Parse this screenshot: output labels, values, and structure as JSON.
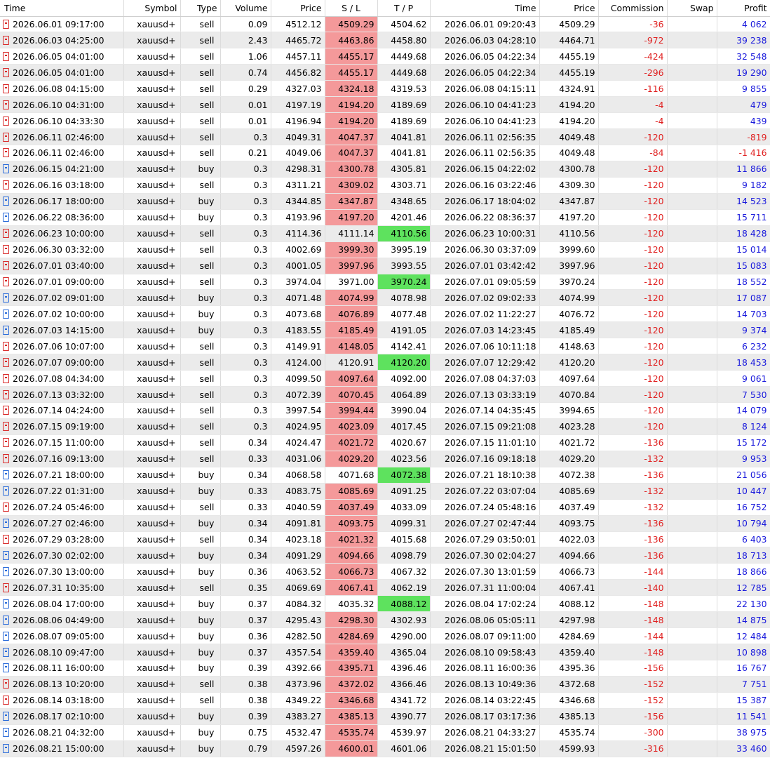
{
  "columns": [
    "Time",
    "Symbol",
    "Type",
    "Volume",
    "Price",
    "S / L",
    "T / P",
    "Time",
    "Price",
    "Commission",
    "Swap",
    "Profit"
  ],
  "rows": [
    {
      "t": "2026.06.01 09:17:00",
      "s": "xauusd+",
      "ty": "sell",
      "v": "0.09",
      "p": "4512.12",
      "sl": "4509.29",
      "tp": "4504.62",
      "ct": "2026.06.01 09:20:43",
      "cp": "4509.29",
      "c": "-36",
      "sw": "",
      "pr": "4 062",
      "hit": "sl"
    },
    {
      "t": "2026.06.03 04:25:00",
      "s": "xauusd+",
      "ty": "sell",
      "v": "2.43",
      "p": "4465.72",
      "sl": "4463.86",
      "tp": "4458.80",
      "ct": "2026.06.03 04:28:10",
      "cp": "4464.71",
      "c": "-972",
      "sw": "",
      "pr": "39 238",
      "hit": "sl"
    },
    {
      "t": "2026.06.05 04:01:00",
      "s": "xauusd+",
      "ty": "sell",
      "v": "1.06",
      "p": "4457.11",
      "sl": "4455.17",
      "tp": "4449.68",
      "ct": "2026.06.05 04:22:34",
      "cp": "4455.19",
      "c": "-424",
      "sw": "",
      "pr": "32 548",
      "hit": "sl"
    },
    {
      "t": "2026.06.05 04:01:00",
      "s": "xauusd+",
      "ty": "sell",
      "v": "0.74",
      "p": "4456.82",
      "sl": "4455.17",
      "tp": "4449.68",
      "ct": "2026.06.05 04:22:34",
      "cp": "4455.19",
      "c": "-296",
      "sw": "",
      "pr": "19 290",
      "hit": "sl"
    },
    {
      "t": "2026.06.08 04:15:00",
      "s": "xauusd+",
      "ty": "sell",
      "v": "0.29",
      "p": "4327.03",
      "sl": "4324.18",
      "tp": "4319.53",
      "ct": "2026.06.08 04:15:11",
      "cp": "4324.91",
      "c": "-116",
      "sw": "",
      "pr": "9 855",
      "hit": "sl"
    },
    {
      "t": "2026.06.10 04:31:00",
      "s": "xauusd+",
      "ty": "sell",
      "v": "0.01",
      "p": "4197.19",
      "sl": "4194.20",
      "tp": "4189.69",
      "ct": "2026.06.10 04:41:23",
      "cp": "4194.20",
      "c": "-4",
      "sw": "",
      "pr": "479",
      "hit": "sl"
    },
    {
      "t": "2026.06.10 04:33:30",
      "s": "xauusd+",
      "ty": "sell",
      "v": "0.01",
      "p": "4196.94",
      "sl": "4194.20",
      "tp": "4189.69",
      "ct": "2026.06.10 04:41:23",
      "cp": "4194.20",
      "c": "-4",
      "sw": "",
      "pr": "439",
      "hit": "sl"
    },
    {
      "t": "2026.06.11 02:46:00",
      "s": "xauusd+",
      "ty": "sell",
      "v": "0.3",
      "p": "4049.31",
      "sl": "4047.37",
      "tp": "4041.81",
      "ct": "2026.06.11 02:56:35",
      "cp": "4049.48",
      "c": "-120",
      "sw": "",
      "pr": "-819",
      "hit": "sl"
    },
    {
      "t": "2026.06.11 02:46:00",
      "s": "xauusd+",
      "ty": "sell",
      "v": "0.21",
      "p": "4049.06",
      "sl": "4047.37",
      "tp": "4041.81",
      "ct": "2026.06.11 02:56:35",
      "cp": "4049.48",
      "c": "-84",
      "sw": "",
      "pr": "-1 416",
      "hit": "sl"
    },
    {
      "t": "2026.06.15 04:21:00",
      "s": "xauusd+",
      "ty": "buy",
      "v": "0.3",
      "p": "4298.31",
      "sl": "4300.78",
      "tp": "4305.81",
      "ct": "2026.06.15 04:22:02",
      "cp": "4300.78",
      "c": "-120",
      "sw": "",
      "pr": "11 866",
      "hit": "sl"
    },
    {
      "t": "2026.06.16 03:18:00",
      "s": "xauusd+",
      "ty": "sell",
      "v": "0.3",
      "p": "4311.21",
      "sl": "4309.02",
      "tp": "4303.71",
      "ct": "2026.06.16 03:22:46",
      "cp": "4309.30",
      "c": "-120",
      "sw": "",
      "pr": "9 182",
      "hit": "sl"
    },
    {
      "t": "2026.06.17 18:00:00",
      "s": "xauusd+",
      "ty": "buy",
      "v": "0.3",
      "p": "4344.85",
      "sl": "4347.87",
      "tp": "4348.65",
      "ct": "2026.06.17 18:04:02",
      "cp": "4347.87",
      "c": "-120",
      "sw": "",
      "pr": "14 523",
      "hit": "sl"
    },
    {
      "t": "2026.06.22 08:36:00",
      "s": "xauusd+",
      "ty": "buy",
      "v": "0.3",
      "p": "4193.96",
      "sl": "4197.20",
      "tp": "4201.46",
      "ct": "2026.06.22 08:36:37",
      "cp": "4197.20",
      "c": "-120",
      "sw": "",
      "pr": "15 711",
      "hit": "sl"
    },
    {
      "t": "2026.06.23 10:00:00",
      "s": "xauusd+",
      "ty": "sell",
      "v": "0.3",
      "p": "4114.36",
      "sl": "4111.14",
      "tp": "4110.56",
      "ct": "2026.06.23 10:00:31",
      "cp": "4110.56",
      "c": "-120",
      "sw": "",
      "pr": "18 428",
      "hit": "tp"
    },
    {
      "t": "2026.06.30 03:32:00",
      "s": "xauusd+",
      "ty": "sell",
      "v": "0.3",
      "p": "4002.69",
      "sl": "3999.30",
      "tp": "3995.19",
      "ct": "2026.06.30 03:37:09",
      "cp": "3999.60",
      "c": "-120",
      "sw": "",
      "pr": "15 014",
      "hit": "sl"
    },
    {
      "t": "2026.07.01 03:40:00",
      "s": "xauusd+",
      "ty": "sell",
      "v": "0.3",
      "p": "4001.05",
      "sl": "3997.96",
      "tp": "3993.55",
      "ct": "2026.07.01 03:42:42",
      "cp": "3997.96",
      "c": "-120",
      "sw": "",
      "pr": "15 083",
      "hit": "sl"
    },
    {
      "t": "2026.07.01 09:00:00",
      "s": "xauusd+",
      "ty": "sell",
      "v": "0.3",
      "p": "3974.04",
      "sl": "3971.00",
      "tp": "3970.24",
      "ct": "2026.07.01 09:05:59",
      "cp": "3970.24",
      "c": "-120",
      "sw": "",
      "pr": "18 552",
      "hit": "tp"
    },
    {
      "t": "2026.07.02 09:01:00",
      "s": "xauusd+",
      "ty": "buy",
      "v": "0.3",
      "p": "4071.48",
      "sl": "4074.99",
      "tp": "4078.98",
      "ct": "2026.07.02 09:02:33",
      "cp": "4074.99",
      "c": "-120",
      "sw": "",
      "pr": "17 087",
      "hit": "sl"
    },
    {
      "t": "2026.07.02 10:00:00",
      "s": "xauusd+",
      "ty": "buy",
      "v": "0.3",
      "p": "4073.68",
      "sl": "4076.89",
      "tp": "4077.48",
      "ct": "2026.07.02 11:22:27",
      "cp": "4076.72",
      "c": "-120",
      "sw": "",
      "pr": "14 703",
      "hit": "sl"
    },
    {
      "t": "2026.07.03 14:15:00",
      "s": "xauusd+",
      "ty": "buy",
      "v": "0.3",
      "p": "4183.55",
      "sl": "4185.49",
      "tp": "4191.05",
      "ct": "2026.07.03 14:23:45",
      "cp": "4185.49",
      "c": "-120",
      "sw": "",
      "pr": "9 374",
      "hit": "sl"
    },
    {
      "t": "2026.07.06 10:07:00",
      "s": "xauusd+",
      "ty": "sell",
      "v": "0.3",
      "p": "4149.91",
      "sl": "4148.05",
      "tp": "4142.41",
      "ct": "2026.07.06 10:11:18",
      "cp": "4148.63",
      "c": "-120",
      "sw": "",
      "pr": "6 232",
      "hit": "sl"
    },
    {
      "t": "2026.07.07 09:00:00",
      "s": "xauusd+",
      "ty": "sell",
      "v": "0.3",
      "p": "4124.00",
      "sl": "4120.91",
      "tp": "4120.20",
      "ct": "2026.07.07 12:29:42",
      "cp": "4120.20",
      "c": "-120",
      "sw": "",
      "pr": "18 453",
      "hit": "tp"
    },
    {
      "t": "2026.07.08 04:34:00",
      "s": "xauusd+",
      "ty": "sell",
      "v": "0.3",
      "p": "4099.50",
      "sl": "4097.64",
      "tp": "4092.00",
      "ct": "2026.07.08 04:37:03",
      "cp": "4097.64",
      "c": "-120",
      "sw": "",
      "pr": "9 061",
      "hit": "sl"
    },
    {
      "t": "2026.07.13 03:32:00",
      "s": "xauusd+",
      "ty": "sell",
      "v": "0.3",
      "p": "4072.39",
      "sl": "4070.45",
      "tp": "4064.89",
      "ct": "2026.07.13 03:33:19",
      "cp": "4070.84",
      "c": "-120",
      "sw": "",
      "pr": "7 530",
      "hit": "sl"
    },
    {
      "t": "2026.07.14 04:24:00",
      "s": "xauusd+",
      "ty": "sell",
      "v": "0.3",
      "p": "3997.54",
      "sl": "3994.44",
      "tp": "3990.04",
      "ct": "2026.07.14 04:35:45",
      "cp": "3994.65",
      "c": "-120",
      "sw": "",
      "pr": "14 079",
      "hit": "sl"
    },
    {
      "t": "2026.07.15 09:19:00",
      "s": "xauusd+",
      "ty": "sell",
      "v": "0.3",
      "p": "4024.95",
      "sl": "4023.09",
      "tp": "4017.45",
      "ct": "2026.07.15 09:21:08",
      "cp": "4023.28",
      "c": "-120",
      "sw": "",
      "pr": "8 124",
      "hit": "sl"
    },
    {
      "t": "2026.07.15 11:00:00",
      "s": "xauusd+",
      "ty": "sell",
      "v": "0.34",
      "p": "4024.47",
      "sl": "4021.72",
      "tp": "4020.67",
      "ct": "2026.07.15 11:01:10",
      "cp": "4021.72",
      "c": "-136",
      "sw": "",
      "pr": "15 172",
      "hit": "sl"
    },
    {
      "t": "2026.07.16 09:13:00",
      "s": "xauusd+",
      "ty": "sell",
      "v": "0.33",
      "p": "4031.06",
      "sl": "4029.20",
      "tp": "4023.56",
      "ct": "2026.07.16 09:18:18",
      "cp": "4029.20",
      "c": "-132",
      "sw": "",
      "pr": "9 953",
      "hit": "sl"
    },
    {
      "t": "2026.07.21 18:00:00",
      "s": "xauusd+",
      "ty": "buy",
      "v": "0.34",
      "p": "4068.58",
      "sl": "4071.68",
      "tp": "4072.38",
      "ct": "2026.07.21 18:10:38",
      "cp": "4072.38",
      "c": "-136",
      "sw": "",
      "pr": "21 056",
      "hit": "tp"
    },
    {
      "t": "2026.07.22 01:31:00",
      "s": "xauusd+",
      "ty": "buy",
      "v": "0.33",
      "p": "4083.75",
      "sl": "4085.69",
      "tp": "4091.25",
      "ct": "2026.07.22 03:07:04",
      "cp": "4085.69",
      "c": "-132",
      "sw": "",
      "pr": "10 447",
      "hit": "sl"
    },
    {
      "t": "2026.07.24 05:46:00",
      "s": "xauusd+",
      "ty": "sell",
      "v": "0.33",
      "p": "4040.59",
      "sl": "4037.49",
      "tp": "4033.09",
      "ct": "2026.07.24 05:48:16",
      "cp": "4037.49",
      "c": "-132",
      "sw": "",
      "pr": "16 752",
      "hit": "sl"
    },
    {
      "t": "2026.07.27 02:46:00",
      "s": "xauusd+",
      "ty": "buy",
      "v": "0.34",
      "p": "4091.81",
      "sl": "4093.75",
      "tp": "4099.31",
      "ct": "2026.07.27 02:47:44",
      "cp": "4093.75",
      "c": "-136",
      "sw": "",
      "pr": "10 794",
      "hit": "sl"
    },
    {
      "t": "2026.07.29 03:28:00",
      "s": "xauusd+",
      "ty": "sell",
      "v": "0.34",
      "p": "4023.18",
      "sl": "4021.32",
      "tp": "4015.68",
      "ct": "2026.07.29 03:50:01",
      "cp": "4022.03",
      "c": "-136",
      "sw": "",
      "pr": "6 403",
      "hit": "sl"
    },
    {
      "t": "2026.07.30 02:02:00",
      "s": "xauusd+",
      "ty": "buy",
      "v": "0.34",
      "p": "4091.29",
      "sl": "4094.66",
      "tp": "4098.79",
      "ct": "2026.07.30 02:04:27",
      "cp": "4094.66",
      "c": "-136",
      "sw": "",
      "pr": "18 713",
      "hit": "sl"
    },
    {
      "t": "2026.07.30 13:00:00",
      "s": "xauusd+",
      "ty": "buy",
      "v": "0.36",
      "p": "4063.52",
      "sl": "4066.73",
      "tp": "4067.32",
      "ct": "2026.07.30 13:01:59",
      "cp": "4066.73",
      "c": "-144",
      "sw": "",
      "pr": "18 866",
      "hit": "sl"
    },
    {
      "t": "2026.07.31 10:35:00",
      "s": "xauusd+",
      "ty": "sell",
      "v": "0.35",
      "p": "4069.69",
      "sl": "4067.41",
      "tp": "4062.19",
      "ct": "2026.07.31 11:00:04",
      "cp": "4067.41",
      "c": "-140",
      "sw": "",
      "pr": "12 785",
      "hit": "sl"
    },
    {
      "t": "2026.08.04 17:00:00",
      "s": "xauusd+",
      "ty": "buy",
      "v": "0.37",
      "p": "4084.32",
      "sl": "4035.32",
      "tp": "4088.12",
      "ct": "2026.08.04 17:02:24",
      "cp": "4088.12",
      "c": "-148",
      "sw": "",
      "pr": "22 130",
      "hit": "tp"
    },
    {
      "t": "2026.08.06 04:49:00",
      "s": "xauusd+",
      "ty": "buy",
      "v": "0.37",
      "p": "4295.43",
      "sl": "4298.30",
      "tp": "4302.93",
      "ct": "2026.08.06 05:05:11",
      "cp": "4297.98",
      "c": "-148",
      "sw": "",
      "pr": "14 875",
      "hit": "sl"
    },
    {
      "t": "2026.08.07 09:05:00",
      "s": "xauusd+",
      "ty": "buy",
      "v": "0.36",
      "p": "4282.50",
      "sl": "4284.69",
      "tp": "4290.00",
      "ct": "2026.08.07 09:11:00",
      "cp": "4284.69",
      "c": "-144",
      "sw": "",
      "pr": "12 484",
      "hit": "sl"
    },
    {
      "t": "2026.08.10 09:47:00",
      "s": "xauusd+",
      "ty": "buy",
      "v": "0.37",
      "p": "4357.54",
      "sl": "4359.40",
      "tp": "4365.04",
      "ct": "2026.08.10 09:58:43",
      "cp": "4359.40",
      "c": "-148",
      "sw": "",
      "pr": "10 898",
      "hit": "sl"
    },
    {
      "t": "2026.08.11 16:00:00",
      "s": "xauusd+",
      "ty": "buy",
      "v": "0.39",
      "p": "4392.66",
      "sl": "4395.71",
      "tp": "4396.46",
      "ct": "2026.08.11 16:00:36",
      "cp": "4395.36",
      "c": "-156",
      "sw": "",
      "pr": "16 767",
      "hit": "sl"
    },
    {
      "t": "2026.08.13 10:20:00",
      "s": "xauusd+",
      "ty": "sell",
      "v": "0.38",
      "p": "4373.96",
      "sl": "4372.02",
      "tp": "4366.46",
      "ct": "2026.08.13 10:49:36",
      "cp": "4372.68",
      "c": "-152",
      "sw": "",
      "pr": "7 751",
      "hit": "sl"
    },
    {
      "t": "2026.08.14 03:18:00",
      "s": "xauusd+",
      "ty": "sell",
      "v": "0.38",
      "p": "4349.22",
      "sl": "4346.68",
      "tp": "4341.72",
      "ct": "2026.08.14 03:22:45",
      "cp": "4346.68",
      "c": "-152",
      "sw": "",
      "pr": "15 387",
      "hit": "sl"
    },
    {
      "t": "2026.08.17 02:10:00",
      "s": "xauusd+",
      "ty": "buy",
      "v": "0.39",
      "p": "4383.27",
      "sl": "4385.13",
      "tp": "4390.77",
      "ct": "2026.08.17 03:17:36",
      "cp": "4385.13",
      "c": "-156",
      "sw": "",
      "pr": "11 541",
      "hit": "sl"
    },
    {
      "t": "2026.08.21 04:32:00",
      "s": "xauusd+",
      "ty": "buy",
      "v": "0.75",
      "p": "4532.47",
      "sl": "4535.74",
      "tp": "4539.97",
      "ct": "2026.08.21 04:33:27",
      "cp": "4535.74",
      "c": "-300",
      "sw": "",
      "pr": "38 975",
      "hit": "sl"
    },
    {
      "t": "2026.08.21 15:00:00",
      "s": "xauusd+",
      "ty": "buy",
      "v": "0.79",
      "p": "4597.26",
      "sl": "4600.01",
      "tp": "4601.06",
      "ct": "2026.08.21 15:01:50",
      "cp": "4599.93",
      "c": "-316",
      "sw": "",
      "pr": "33 460",
      "hit": "sl"
    }
  ],
  "colors": {
    "sl_hit": "#f4999a",
    "tp_hit": "#5ee25e",
    "sell_icon": "#d92a2a",
    "buy_icon": "#2a6bd9",
    "negative": "#e02020",
    "positive": "#1a1adc"
  },
  "icons": {
    "sell": "sell-order-icon",
    "buy": "buy-order-icon"
  }
}
